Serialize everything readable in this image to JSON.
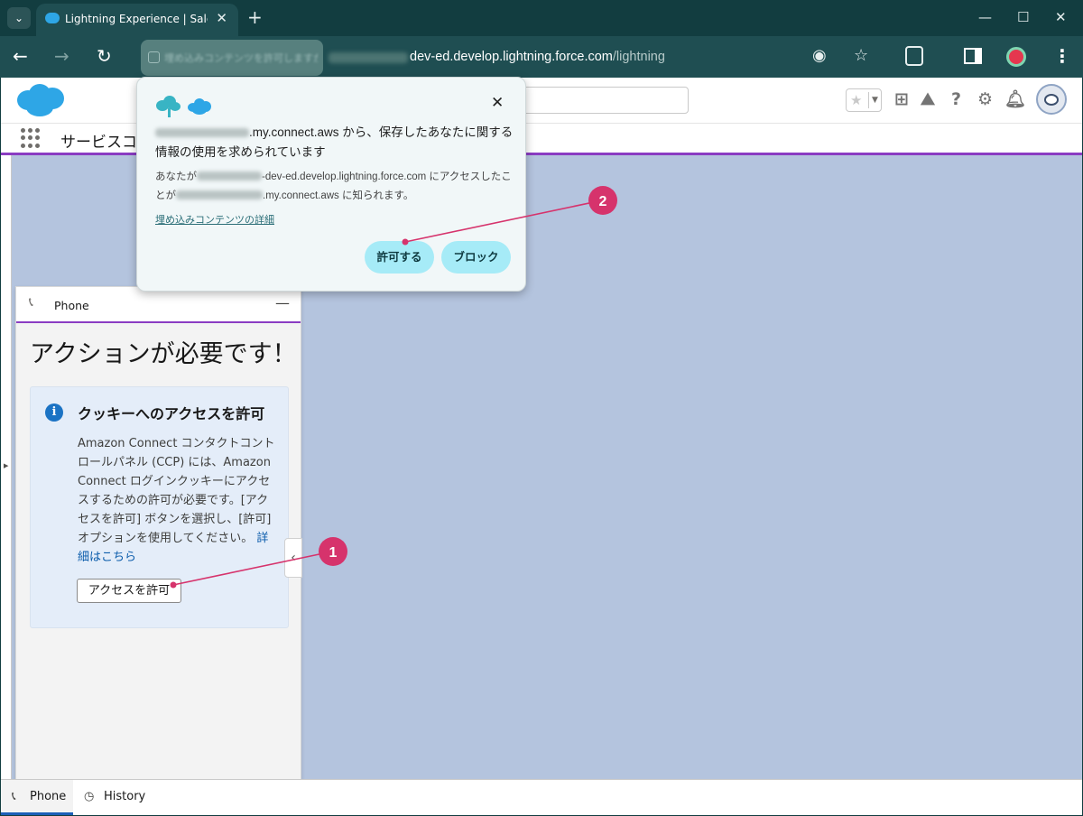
{
  "browser": {
    "tab_title": "Lightning Experience | Sales",
    "url_domain": "dev-ed.develop.lightning.force.com",
    "url_path": "/lightning",
    "site_chip_text": "埋め込みコンテンツを許可しますか？"
  },
  "salesforce": {
    "app_name": "サービスコンソール"
  },
  "permission_popup": {
    "question_domain": ".my.connect.aws",
    "question_rest": " から、保存したあなたに関する情報の使用を求められています",
    "desc_prefix": "あなたが",
    "desc_domain": "-dev-ed.develop.lightning.force.com",
    "desc_middle": " にアクセスしたことが",
    "desc_domain2": ".my.connect.aws",
    "desc_suffix": " に知られます。",
    "link": "埋め込みコンテンツの詳細",
    "allow_label": "許可する",
    "block_label": "ブロック"
  },
  "phone_panel": {
    "title": "Phone",
    "heading": "アクションが必要です！",
    "card_title": "クッキーへのアクセスを許可",
    "card_body": "Amazon Connect コンタクトコントロールパネル (CCP) には、Amazon Connect ログインクッキーにアクセスするための許可が必要です。[アクセスを許可] ボタンを選択し、[許可] オプションを使用してください。",
    "card_link": "詳細はこちら",
    "allow_button": "アクセスを許可"
  },
  "utility_bar": {
    "phone_label": "Phone",
    "history_label": "History"
  },
  "annotations": {
    "marker_1": "1",
    "marker_2": "2",
    "color": "#d6336c"
  },
  "colors": {
    "chrome_bg": "#123d40",
    "toolbar_bg": "#1f4e52",
    "page_bg": "#b4c4de",
    "salesforce_blue": "#2ea6e6",
    "nav_accent": "#8a3cc2",
    "popup_button": "#a6ebf7"
  }
}
